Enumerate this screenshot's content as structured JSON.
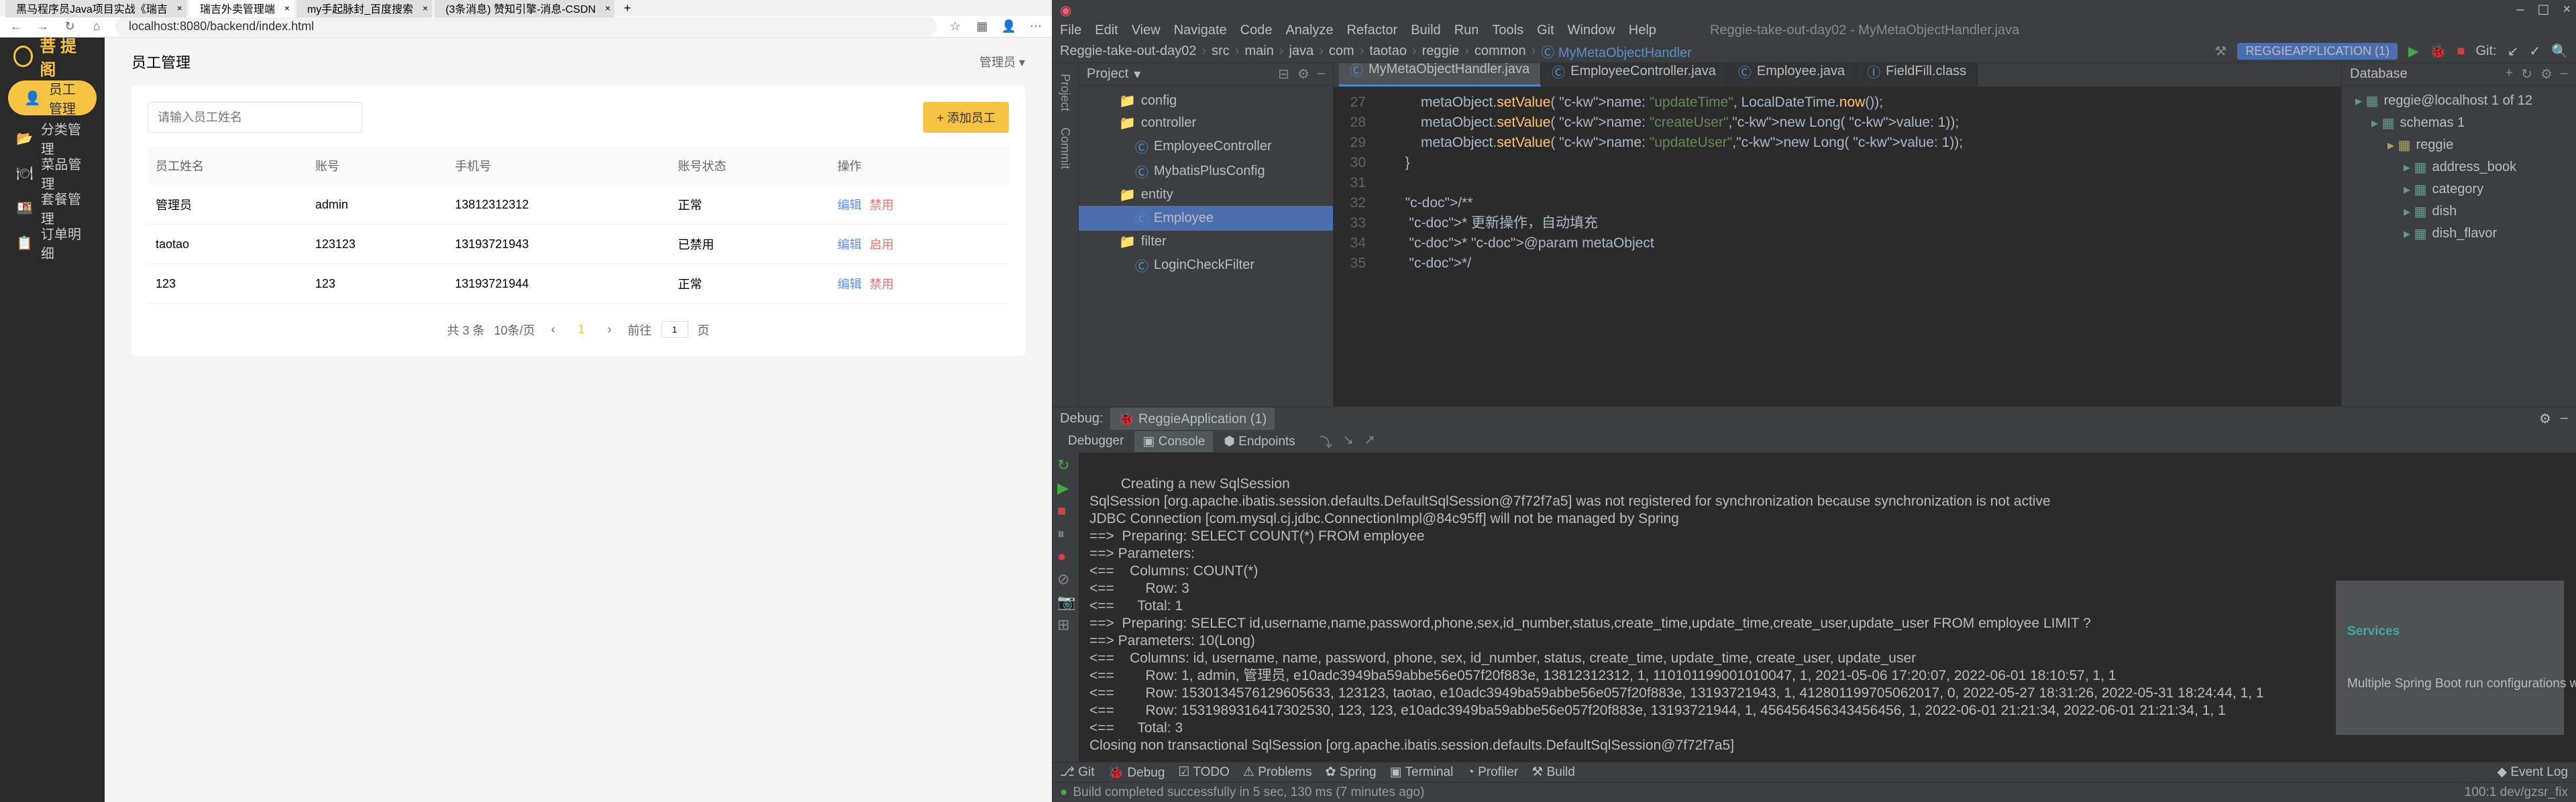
{
  "browser": {
    "tabs": [
      {
        "title": "黑马程序员Java项目实战《瑞吉"
      },
      {
        "title": "瑞吉外卖管理端"
      },
      {
        "title": "my手起脉封_百度搜索"
      },
      {
        "title": "(3条消息) 赞知引擎-消息-CSDN"
      }
    ],
    "url": "localhost:8080/backend/index.html",
    "nav_icons": [
      "←",
      "→",
      "↻",
      "⌂"
    ]
  },
  "app": {
    "logo": "菩 提 阁",
    "nav": [
      {
        "icon": "👤",
        "label": "员工管理"
      },
      {
        "icon": "📂",
        "label": "分类管理"
      },
      {
        "icon": "🍽",
        "label": "菜品管理"
      },
      {
        "icon": "🍱",
        "label": "套餐管理"
      },
      {
        "icon": "📋",
        "label": "订单明细"
      }
    ],
    "page_title": "员工管理",
    "user": "管理员",
    "search_placeholder": "请输入员工姓名",
    "add_btn": "+ 添加员工",
    "columns": [
      "员工姓名",
      "账号",
      "手机号",
      "账号状态",
      "操作"
    ],
    "rows": [
      {
        "name": "管理员",
        "account": "admin",
        "phone": "13812312312",
        "status": "正常",
        "a1": "编辑",
        "a2": "禁用"
      },
      {
        "name": "taotao",
        "account": "123123",
        "phone": "13193721943",
        "status": "已禁用",
        "a1": "编辑",
        "a2": "启用"
      },
      {
        "name": "123",
        "account": "123",
        "phone": "13193721944",
        "status": "正常",
        "a1": "编辑",
        "a2": "禁用"
      }
    ],
    "pagination": {
      "total": "共 3 条",
      "per": "10条/页",
      "page": "1",
      "goto": "前往",
      "page_unit": "页"
    }
  },
  "ide": {
    "title": "Reggie-take-out-day02 - MyMetaObjectHandler.java",
    "menu": [
      "File",
      "Edit",
      "View",
      "Navigate",
      "Code",
      "Analyze",
      "Refactor",
      "Build",
      "Run",
      "Tools",
      "Git",
      "Window",
      "Help"
    ],
    "run_config": "REGGIEAPPLICATION (1)",
    "crumbs": [
      "Reggie-take-out-day02",
      "src",
      "main",
      "java",
      "com",
      "taotao",
      "reggie",
      "common",
      "MyMetaObjectHandler"
    ],
    "project_label": "Project",
    "tree": [
      {
        "ind": 60,
        "icon": "📁",
        "label": "config",
        "color": "#b0a068"
      },
      {
        "ind": 60,
        "icon": "📁",
        "label": "controller",
        "color": "#b0a068"
      },
      {
        "ind": 84,
        "icon": "Ⓒ",
        "label": "EmployeeController",
        "color": "#5b8ec8"
      },
      {
        "ind": 84,
        "icon": "Ⓒ",
        "label": "MybatisPlusConfig",
        "color": "#5b8ec8"
      },
      {
        "ind": 60,
        "icon": "📁",
        "label": "entity",
        "color": "#b0a068"
      },
      {
        "ind": 84,
        "icon": "Ⓒ",
        "label": "Employee",
        "sel": true,
        "color": "#5b8ec8"
      },
      {
        "ind": 60,
        "icon": "📁",
        "label": "filter",
        "color": "#b0a068"
      },
      {
        "ind": 84,
        "icon": "Ⓒ",
        "label": "LoginCheckFilter",
        "color": "#5b8ec8"
      }
    ],
    "editor_tabs": [
      {
        "label": "MyMetaObjectHandler.java",
        "active": true
      },
      {
        "label": "EmployeeController.java"
      },
      {
        "label": "Employee.java"
      },
      {
        "label": "FieldFill.class"
      }
    ],
    "gutter_lines": [
      "27",
      "28",
      "29",
      "30",
      "31",
      "32",
      "33",
      "34",
      "35"
    ],
    "code_lines": [
      "            metaObject.setValue( name: \"updateTime\", LocalDateTime.now());",
      "            metaObject.setValue( name: \"createUser\",new Long( value: 1));",
      "            metaObject.setValue( name: \"updateUser\",new Long( value: 1));",
      "        }",
      "",
      "        /**",
      "         * 更新操作，自动填充",
      "         * @param metaObject",
      "         */"
    ],
    "db": {
      "header": "Database",
      "items": [
        {
          "ind": 20,
          "label": "reggie@localhost  1 of 12"
        },
        {
          "ind": 44,
          "label": "schemas 1"
        },
        {
          "ind": 68,
          "label": "reggie",
          "color": "#b0a068"
        },
        {
          "ind": 92,
          "label": "address_book"
        },
        {
          "ind": 92,
          "label": "category"
        },
        {
          "ind": 92,
          "label": "dish"
        },
        {
          "ind": 92,
          "label": "dish_flavor"
        }
      ]
    },
    "debug": {
      "header": "Debug:",
      "config_tab": "ReggieApplication (1)",
      "tabs": [
        "Debugger",
        "Console",
        "Endpoints"
      ],
      "console": "Creating a new SqlSession\nSqlSession [org.apache.ibatis.session.defaults.DefaultSqlSession@7f72f7a5] was not registered for synchronization because synchronization is not active\nJDBC Connection [com.mysql.cj.jdbc.ConnectionImpl@84c95ff] will not be managed by Spring\n==>  Preparing: SELECT COUNT(*) FROM employee\n==> Parameters:\n<==    Columns: COUNT(*)\n<==        Row: 3\n<==      Total: 1\n==>  Preparing: SELECT id,username,name,password,phone,sex,id_number,status,create_time,update_time,create_user,update_user FROM employee LIMIT ?\n==> Parameters: 10(Long)\n<==    Columns: id, username, name, password, phone, sex, id_number, status, create_time, update_time, create_user, update_user\n<==        Row: 1, admin, 管理员, e10adc3949ba59abbe56e057f20f883e, 13812312312, 1, 110101199001010047, 1, 2021-05-06 17:20:07, 2022-06-01 18:10:57, 1, 1\n<==        Row: 1530134576129605633, 123123, taotao, e10adc3949ba59abbe56e057f20f883e, 13193721943, 1, 412801199705062017, 0, 2022-05-27 18:31:26, 2022-05-31 18:24:44, 1, 1\n<==        Row: 1531989316417302530, 123, 123, e10adc3949ba59abbe56e057f20f883e, 13193721944, 1, 456456456343456456, 1, 2022-06-01 21:21:34, 2022-06-01 21:21:34, 1, 1\n<==      Total: 3\nClosing non transactional SqlSession [org.apache.ibatis.session.defaults.DefaultSqlSession@7f72f7a5]",
      "services": {
        "title": "Services",
        "msg": "Multiple Spring Boot run configurations were detected…"
      }
    },
    "status": {
      "items": [
        "Git",
        "Debug",
        "TODO",
        "Problems",
        "Spring",
        "Terminal",
        "Profiler",
        "Build"
      ],
      "event_log": "Event Log",
      "build_msg": "Build completed successfully in 5 sec, 130 ms (7 minutes ago)",
      "right": "100:1    dev/gzsr_fix"
    }
  }
}
